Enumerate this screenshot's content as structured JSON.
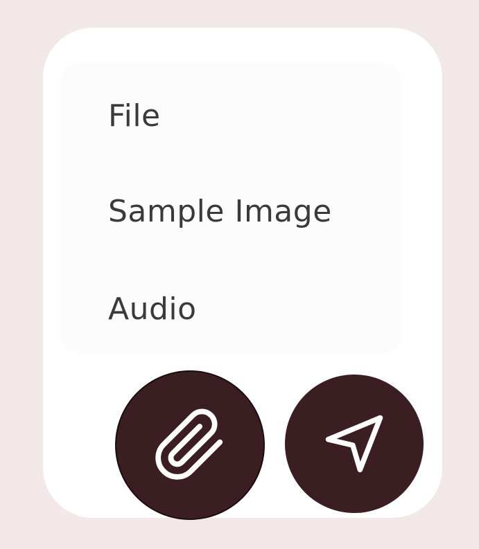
{
  "menu": {
    "items": [
      {
        "label": "File"
      },
      {
        "label": "Sample Image"
      },
      {
        "label": "Audio"
      }
    ]
  },
  "actions": {
    "attach_icon": "paperclip-icon",
    "send_icon": "send-icon"
  },
  "colors": {
    "background": "#f2e8e8",
    "card": "#ffffff",
    "button": "#3a1e22",
    "icon": "#ffffff",
    "text": "#3a3a3a"
  }
}
